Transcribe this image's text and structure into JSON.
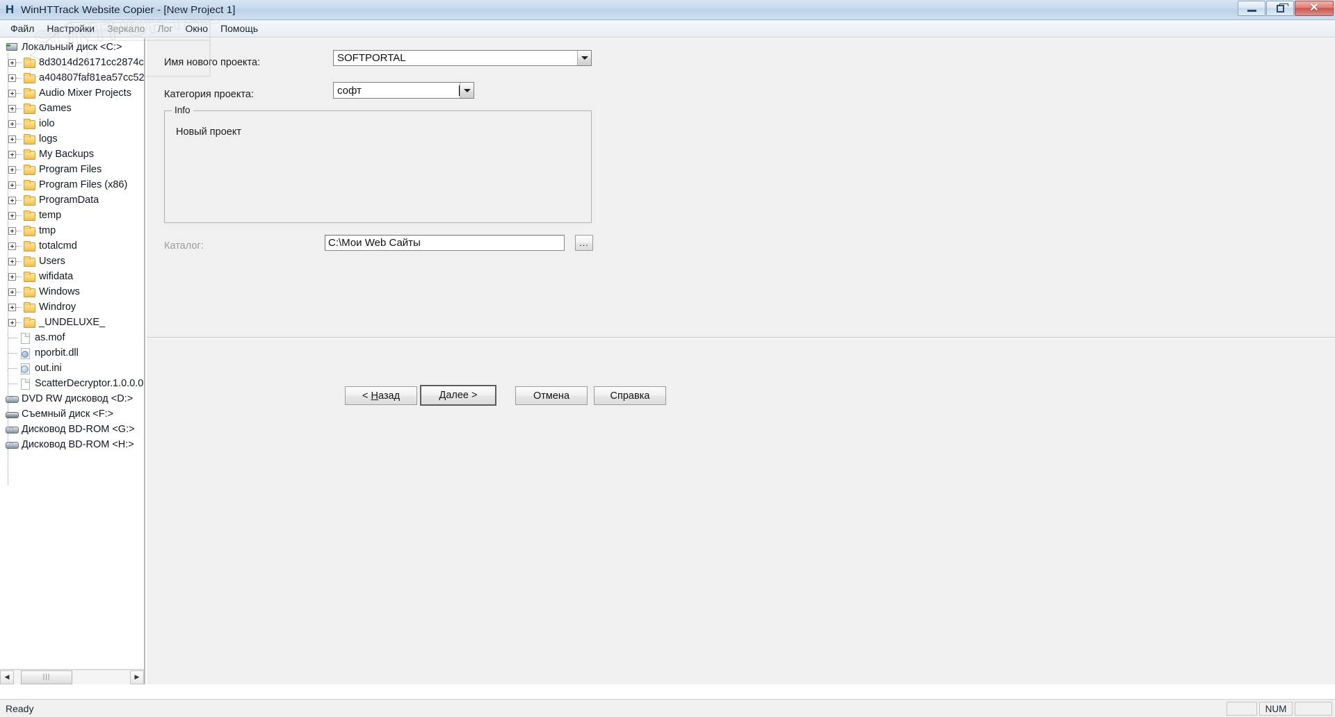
{
  "window": {
    "title": "WinHTTrack Website Copier - [New Project 1]",
    "app_icon": "httrack-h-icon",
    "controls": {
      "minimize": "minimize-icon",
      "maximize": "restore-icon",
      "close": "close-icon"
    }
  },
  "menubar": {
    "items": [
      {
        "label": "Файл",
        "dim": false
      },
      {
        "label": "Настройки",
        "dim": false
      },
      {
        "label": "Зеркало",
        "dim": true
      },
      {
        "label": "Лог",
        "dim": true
      },
      {
        "label": "Окно",
        "dim": false
      },
      {
        "label": "Помощь",
        "dim": false
      }
    ]
  },
  "watermark": {
    "text": "SOFTPORTAL",
    "sub": "www.softportal.com"
  },
  "tree": {
    "root": {
      "label": "Локальный диск <C:>",
      "icon": "computer-drive-icon"
    },
    "items": [
      {
        "label": "8d3014d26171cc2874c",
        "icon": "folder-icon",
        "expandable": true,
        "indent": 1
      },
      {
        "label": "a404807faf81ea57cc52",
        "icon": "folder-icon",
        "expandable": true,
        "indent": 1
      },
      {
        "label": "Audio Mixer Projects",
        "icon": "folder-icon",
        "expandable": true,
        "indent": 1
      },
      {
        "label": "Games",
        "icon": "folder-icon",
        "expandable": true,
        "indent": 1
      },
      {
        "label": "iolo",
        "icon": "folder-icon",
        "expandable": true,
        "indent": 1
      },
      {
        "label": "logs",
        "icon": "folder-icon",
        "expandable": true,
        "indent": 1
      },
      {
        "label": "My Backups",
        "icon": "folder-icon",
        "expandable": true,
        "indent": 1
      },
      {
        "label": "Program Files",
        "icon": "folder-icon",
        "expandable": true,
        "indent": 1
      },
      {
        "label": "Program Files (x86)",
        "icon": "folder-icon",
        "expandable": true,
        "indent": 1
      },
      {
        "label": "ProgramData",
        "icon": "folder-icon",
        "expandable": true,
        "indent": 1
      },
      {
        "label": "temp",
        "icon": "folder-icon",
        "expandable": true,
        "indent": 1
      },
      {
        "label": "tmp",
        "icon": "folder-icon",
        "expandable": true,
        "indent": 1
      },
      {
        "label": "totalcmd",
        "icon": "folder-icon",
        "expandable": true,
        "indent": 1
      },
      {
        "label": "Users",
        "icon": "folder-icon",
        "expandable": true,
        "indent": 1
      },
      {
        "label": "wifidata",
        "icon": "folder-icon",
        "expandable": true,
        "indent": 1
      },
      {
        "label": "Windows",
        "icon": "folder-icon",
        "expandable": true,
        "indent": 1
      },
      {
        "label": "Windroy",
        "icon": "folder-icon",
        "expandable": true,
        "indent": 1
      },
      {
        "label": "_UNDELUXE_",
        "icon": "folder-icon",
        "expandable": true,
        "indent": 1
      },
      {
        "label": "as.mof",
        "icon": "file-icon",
        "expandable": false,
        "indent": 1
      },
      {
        "label": "nporbit.dll",
        "icon": "dll-file-icon",
        "expandable": false,
        "indent": 1
      },
      {
        "label": "out.ini",
        "icon": "ini-file-icon",
        "expandable": false,
        "indent": 1
      },
      {
        "label": "ScatterDecryptor.1.0.0.0",
        "icon": "file-icon",
        "expandable": false,
        "indent": 1
      },
      {
        "label": "DVD RW дисковод <D:>",
        "icon": "cdrom-drive-icon",
        "expandable": false,
        "indent": 0
      },
      {
        "label": "Съемный диск <F:>",
        "icon": "removable-drive-icon",
        "expandable": false,
        "indent": 0
      },
      {
        "label": "Дисковод BD-ROM <G:>",
        "icon": "cdrom-drive-icon",
        "expandable": false,
        "indent": 0
      },
      {
        "label": "Дисковод BD-ROM <H:>",
        "icon": "cdrom-drive-icon",
        "expandable": false,
        "indent": 0
      }
    ],
    "hscrollbar": {
      "left_arrow": "arrow-left-icon",
      "right_arrow": "arrow-right-icon",
      "thumb_grip": "|||"
    }
  },
  "form": {
    "project_name": {
      "label": "Имя нового проекта:",
      "value": "SOFTPORTAL",
      "placeholder": ""
    },
    "project_category": {
      "label": "Категория проекта:",
      "value": "софт",
      "placeholder": ""
    },
    "info_group": {
      "title": "Info",
      "text": "Новый проект"
    },
    "catalog": {
      "label": "Каталог:",
      "value": "C:\\Мои Web Сайты",
      "placeholder": "",
      "disabled_label": true,
      "browse_button": "..."
    },
    "buttons": {
      "back": {
        "prefix": "< ",
        "accel": "Н",
        "rest": "азад"
      },
      "next": {
        "accel": "Д",
        "rest": "алее",
        "suffix": " >"
      },
      "cancel": "Отмена",
      "help": "Справка"
    }
  },
  "statusbar": {
    "text": "Ready",
    "panes": [
      "",
      "NUM",
      ""
    ]
  }
}
